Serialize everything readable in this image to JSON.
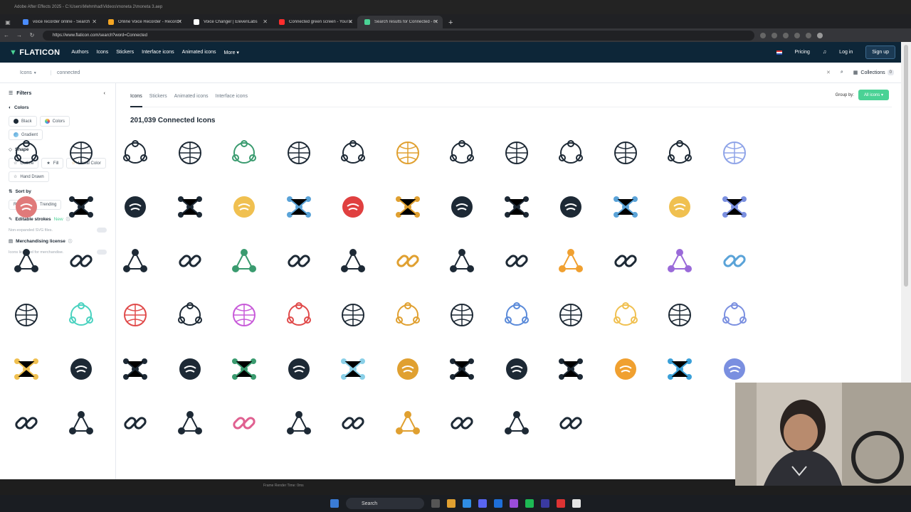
{
  "ae_titlebar": {
    "text": "Adobe After Effects 2025 - C:\\Users\\Mehmhad\\Videos\\moneta 2\\moneta 3.aep"
  },
  "browser": {
    "tabs": [
      {
        "label": "voice recorder online - Search",
        "fav": "#4a8cff"
      },
      {
        "label": "Online Voice Recorder - Record V",
        "fav": "#f5a623"
      },
      {
        "label": "Voice Changer | ElevenLabs",
        "fav": "#ffffff"
      },
      {
        "label": "Connected green screen - YouTub",
        "fav": "#ff2d2d"
      },
      {
        "label": "Search results for Connected - Fl",
        "fav": "#4ad295"
      }
    ],
    "url": "https://www.flaticon.com/search?word=Connected"
  },
  "site": {
    "logo": "FLATICON",
    "nav": [
      "Authors",
      "Icons",
      "Stickers",
      "Interface icons",
      "Animated icons",
      "More ▾"
    ],
    "pricing": "Pricing",
    "login": "Log in",
    "signup": "Sign up",
    "search": {
      "type": "Icons",
      "query": "connected"
    },
    "collections": "Collections",
    "collections_count": "0"
  },
  "filters": {
    "title": "Filters",
    "colors_title": "Colors",
    "colors": [
      {
        "label": "Black",
        "swatch": "#1d2935"
      },
      {
        "label": "Colors",
        "swatch": "#f5c242"
      },
      {
        "label": "Gradient",
        "swatch": "#5aa3d8"
      }
    ],
    "shape_title": "Shape",
    "shapes": [
      "Outline",
      "Fill",
      "Lineal Color",
      "Hand Drawn"
    ],
    "sort_title": "Sort by",
    "sort": [
      "Recent",
      "Trending"
    ],
    "editable_title": "Editable strokes",
    "editable_new": "New",
    "editable_desc": "Non-expanded SVG files.",
    "merch_title": "Merchandising license",
    "merch_desc": "Icons licensed for merchandise."
  },
  "results": {
    "tabs": [
      "Icons",
      "Stickers",
      "Animated icons",
      "Interface icons"
    ],
    "group_by_label": "Group by:",
    "group_by_value": "All icons",
    "count_text": "201,039 Connected Icons"
  },
  "icons": [
    [
      "network-people-icon",
      "globe-network-icon",
      "chain-link-icon",
      "chain-link-bold-icon",
      "hierarchy-icon",
      "triangle-people-icon",
      "wifi-circle-icon",
      "gold-link-icon",
      "hub-icon",
      "org-chart-icon",
      "hexagon-network-icon",
      "circle-nodes-icon",
      "users-icon",
      "blue-web-icon"
    ],
    [
      "people-ring-icon",
      "broken-link-icon",
      "user-network-icon",
      "link-icon",
      "handshake-icon",
      "color-network-icon",
      "puzzle-icon",
      "wifi-icon",
      "molecule-icon",
      "antenna-icon",
      "star-network-icon",
      "team-icon",
      "color-link-icon",
      "knot-icon"
    ],
    [
      "antenna-tower-icon",
      "network-x-icon",
      "plug-icon",
      "triangle-nodes-icon",
      "qr-network-icon",
      "path-icon",
      "people-network-icon",
      "small-hub-icon",
      "bold-people-icon",
      "arrows-icon",
      "plug-color-icon",
      "hands-icon",
      "color-nodes-icon",
      "people-circle-icon"
    ],
    [
      "bold-hub-icon",
      "color-globe-icon",
      "color-person-icon",
      "globe-icon",
      "purple-hex-icon",
      "map-nodes-icon",
      "outline-hub-icon",
      "people-triangle-icon",
      "puzzle-hands-icon",
      "blue-link-icon",
      "tree-icon",
      "presenter-icon",
      "outline-link-icon",
      "people-grid-icon"
    ],
    [
      "speaker-icon",
      "flow-icon",
      "bold-link-icon",
      "updown-icon",
      "cycle-icon",
      "bold-nodes-icon",
      "light-globe-icon",
      "doc-link-icon",
      "sun-network-icon",
      "team-bold-icon",
      "no-signal-icon",
      "gear-net-icon",
      "laptop-net-icon",
      "network-x2-icon"
    ],
    [
      "cut-link-icon",
      "plug-outline-icon",
      "share-icon",
      "org-boxes-icon",
      "plug-spark-icon",
      "two-users-icon",
      "spiky-net-icon",
      "bold-plug-icon",
      "bars-circle-icon",
      "globe-outline-icon",
      "no-wifi-icon"
    ]
  ],
  "taskbar": {
    "search": "Search"
  },
  "overlay": "Frame Render Time: 0ms"
}
